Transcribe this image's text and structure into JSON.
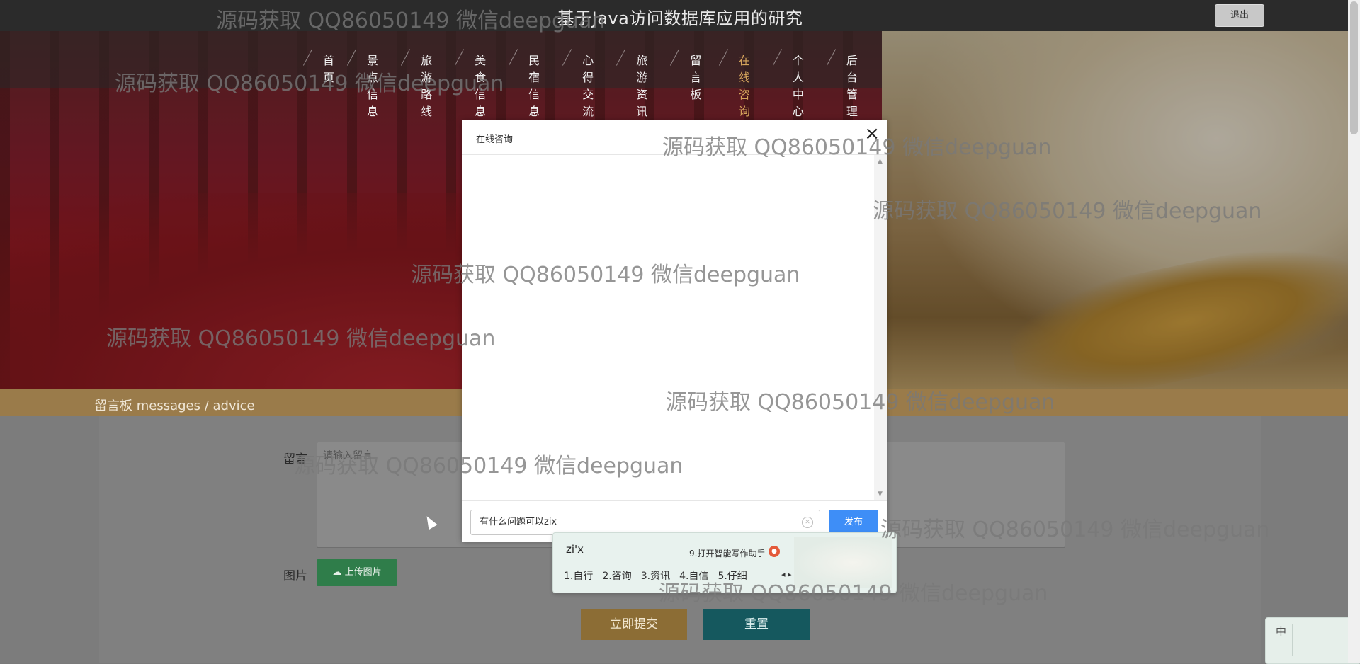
{
  "site": {
    "title": "基于Java访问数据库应用的研究",
    "logout_label": "退出"
  },
  "nav": {
    "items": [
      "首页",
      "景点信息",
      "旅游路线",
      "美食信息",
      "民宿信息",
      "心得交流",
      "旅游资讯",
      "留言板",
      "在线咨询",
      "个人中心",
      "后台管理"
    ],
    "active": "在线咨询"
  },
  "section": {
    "label": "留言板  messages / advice"
  },
  "form": {
    "message_label": "留言",
    "message_placeholder": "请输入留言",
    "image_label": "图片",
    "upload_label": "上传图片",
    "submit_label": "立即提交",
    "reset_label": "重置"
  },
  "modal": {
    "title": "在线咨询",
    "close": "×",
    "input_value": "有什么问题可以zix",
    "publish_label": "发布"
  },
  "ime": {
    "composition": "zi'x",
    "hint": "9.打开智能写作助手",
    "candidates": [
      "1.自行",
      "2.咨询",
      "3.资讯",
      "4.自信",
      "5.仔细"
    ],
    "status_lang": "中"
  },
  "watermark": {
    "text": "源码获取 QQ86050149 微信deepguan"
  },
  "colors": {
    "accent": "#d6a55c",
    "publish": "#3e8ef7",
    "submit": "#8c6d35",
    "reset": "#15585e",
    "upload": "#2f7d4a"
  }
}
